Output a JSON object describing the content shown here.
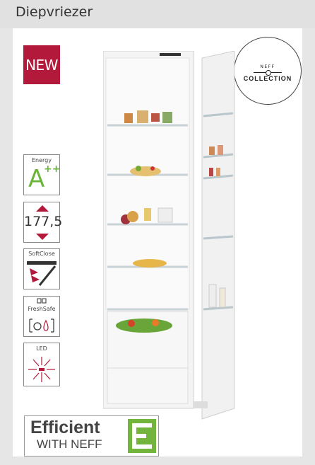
{
  "header": {
    "title": "Diepvriezer"
  },
  "badges": {
    "new": "NEW",
    "collection_top": "NEFF",
    "collection_bottom": "COLLECTION"
  },
  "features": {
    "energy_label": "Energy",
    "energy_rating": "A",
    "energy_plus": "++",
    "height_value": "177,5",
    "softclose_label": "SoftClose",
    "freshsafe_label": "FreshSafe",
    "led_label": "LED"
  },
  "efficient": {
    "line1": "Efficient",
    "line2": "WITH NEFF"
  },
  "colors": {
    "brand_red": "#b3193a",
    "energy_green": "#6ab43a",
    "efficient_green": "#73b43c"
  }
}
